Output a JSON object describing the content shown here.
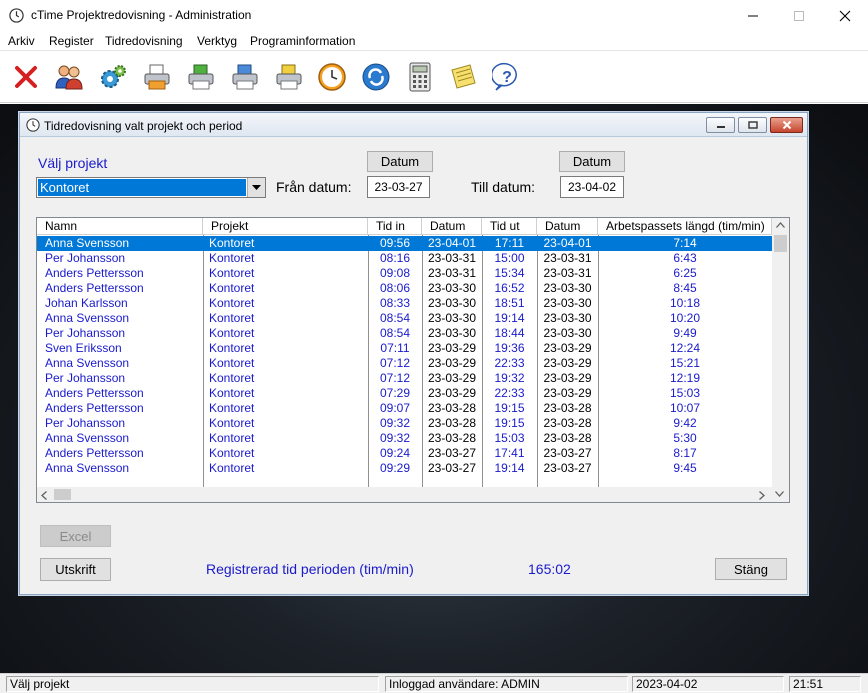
{
  "window": {
    "title": "cTime Projektredovisning - Administration"
  },
  "menu": [
    "Arkiv",
    "Register",
    "Tidredovisning",
    "Verktyg",
    "Programinformation"
  ],
  "toolbar": [
    "close-red-x-icon",
    "users-icon",
    "settings-gears-icon",
    "printer-orange-icon",
    "printer-green-icon",
    "printer-blue-icon",
    "printer-yellow-icon",
    "clock-icon",
    "refresh-blue-icon",
    "calculator-icon",
    "notepad-icon",
    "help-icon"
  ],
  "dialog": {
    "title": "Tidredovisning valt projekt och period",
    "valj_projekt_label": "Välj projekt",
    "project_selected": "Kontoret",
    "fran_label": "Från datum:",
    "till_label": "Till datum:",
    "datum_button": "Datum",
    "fran_value": "23-03-27",
    "till_value": "23-04-02",
    "columns": [
      "Namn",
      "Projekt",
      "Tid in",
      "Datum",
      "Tid ut",
      "Datum",
      "Arbetspassets längd (tim/min)"
    ],
    "rows": [
      [
        "Anna Svensson",
        "Kontoret",
        "09:56",
        "23-04-01",
        "17:11",
        "23-04-01",
        "7:14"
      ],
      [
        "Per Johansson",
        "Kontoret",
        "08:16",
        "23-03-31",
        "15:00",
        "23-03-31",
        "6:43"
      ],
      [
        "Anders Pettersson",
        "Kontoret",
        "09:08",
        "23-03-31",
        "15:34",
        "23-03-31",
        "6:25"
      ],
      [
        "Anders Pettersson",
        "Kontoret",
        "08:06",
        "23-03-30",
        "16:52",
        "23-03-30",
        "8:45"
      ],
      [
        "Johan Karlsson",
        "Kontoret",
        "08:33",
        "23-03-30",
        "18:51",
        "23-03-30",
        "10:18"
      ],
      [
        "Anna Svensson",
        "Kontoret",
        "08:54",
        "23-03-30",
        "19:14",
        "23-03-30",
        "10:20"
      ],
      [
        "Per Johansson",
        "Kontoret",
        "08:54",
        "23-03-30",
        "18:44",
        "23-03-30",
        "9:49"
      ],
      [
        "Sven Eriksson",
        "Kontoret",
        "07:11",
        "23-03-29",
        "19:36",
        "23-03-29",
        "12:24"
      ],
      [
        "Anna Svensson",
        "Kontoret",
        "07:12",
        "23-03-29",
        "22:33",
        "23-03-29",
        "15:21"
      ],
      [
        "Per Johansson",
        "Kontoret",
        "07:12",
        "23-03-29",
        "19:32",
        "23-03-29",
        "12:19"
      ],
      [
        "Anders Pettersson",
        "Kontoret",
        "07:29",
        "23-03-29",
        "22:33",
        "23-03-29",
        "15:03"
      ],
      [
        "Anders Pettersson",
        "Kontoret",
        "09:07",
        "23-03-28",
        "19:15",
        "23-03-28",
        "10:07"
      ],
      [
        "Per Johansson",
        "Kontoret",
        "09:32",
        "23-03-28",
        "19:15",
        "23-03-28",
        "9:42"
      ],
      [
        "Anna Svensson",
        "Kontoret",
        "09:32",
        "23-03-28",
        "15:03",
        "23-03-28",
        "5:30"
      ],
      [
        "Anders Pettersson",
        "Kontoret",
        "09:24",
        "23-03-27",
        "17:41",
        "23-03-27",
        "8:17"
      ],
      [
        "Anna Svensson",
        "Kontoret",
        "09:29",
        "23-03-27",
        "19:14",
        "23-03-27",
        "9:45"
      ]
    ],
    "excel_button": "Excel",
    "print_button": "Utskrift",
    "total_label": "Registrerad tid perioden (tim/min)",
    "total_value": "165:02",
    "close_button": "Stäng"
  },
  "statusbar": {
    "hint": "Välj projekt",
    "user": "Inloggad användare: ADMIN",
    "date": "2023-04-02",
    "time": "21:51"
  },
  "colors": {
    "selection": "#0078d7",
    "label_blue": "#1a1acc"
  }
}
